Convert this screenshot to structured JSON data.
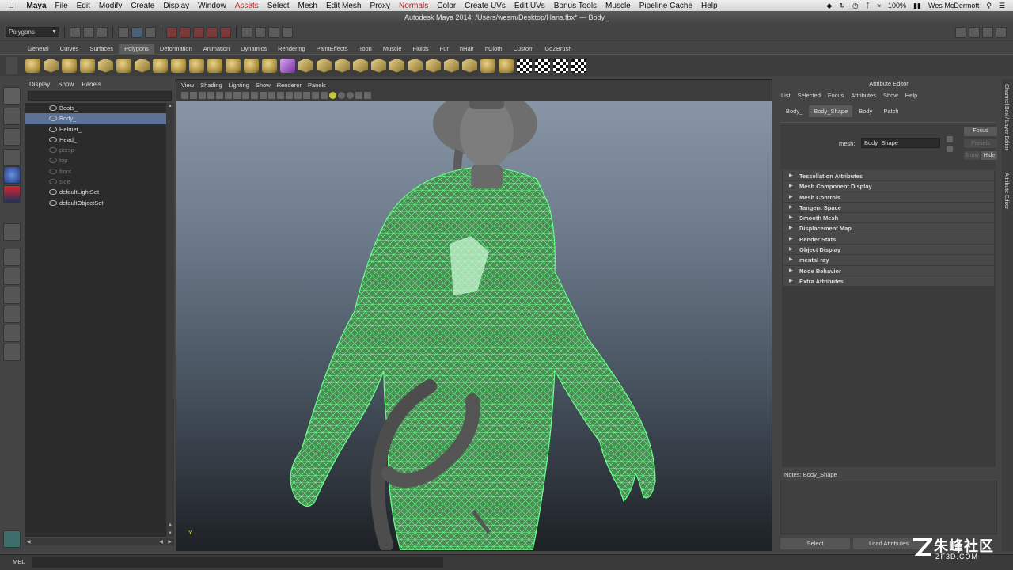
{
  "menubar": {
    "items": [
      "Maya",
      "File",
      "Edit",
      "Modify",
      "Create",
      "Display",
      "Window",
      "Assets",
      "Select",
      "Mesh",
      "Edit Mesh",
      "Proxy",
      "Normals",
      "Color",
      "Create UVs",
      "Edit UVs",
      "Bonus Tools",
      "Muscle",
      "Pipeline Cache",
      "Help"
    ],
    "battery": "100%",
    "user": "Wes McDermott"
  },
  "titlebar": {
    "title": "Autodesk Maya 2014: /Users/wesm/Desktop/Hans.fbx*  ---  Body_"
  },
  "statusline": {
    "menuset": "Polygons"
  },
  "shelf": {
    "tabs": [
      "General",
      "Curves",
      "Surfaces",
      "Polygons",
      "Deformation",
      "Animation",
      "Dynamics",
      "Rendering",
      "PaintEffects",
      "Toon",
      "Muscle",
      "Fluids",
      "Fur",
      "nHair",
      "nCloth",
      "Custom",
      "GoZBrush"
    ],
    "active_tab": "Polygons"
  },
  "outliner": {
    "menu": [
      "Display",
      "Show",
      "Panels"
    ],
    "items": [
      {
        "label": "Boots_",
        "state": "normal"
      },
      {
        "label": "Body_",
        "state": "selected"
      },
      {
        "label": "Helmet_",
        "state": "normal"
      },
      {
        "label": "Head_",
        "state": "normal"
      },
      {
        "label": "persp",
        "state": "dim"
      },
      {
        "label": "top",
        "state": "dim"
      },
      {
        "label": "front",
        "state": "dim"
      },
      {
        "label": "side",
        "state": "dim"
      },
      {
        "label": "defaultLightSet",
        "state": "normal"
      },
      {
        "label": "defaultObjectSet",
        "state": "normal"
      }
    ]
  },
  "viewport": {
    "menu": [
      "View",
      "Shading",
      "Lighting",
      "Show",
      "Renderer",
      "Panels"
    ],
    "axis_label": "Y",
    "wire_color": "#3cff6a"
  },
  "attribute_editor": {
    "title": "Attribute Editor",
    "menu": [
      "List",
      "Selected",
      "Focus",
      "Attributes",
      "Show",
      "Help"
    ],
    "tabs": [
      "Body_",
      "Body_Shape",
      "Body",
      "Patch"
    ],
    "active_tab": "Body_Shape",
    "mesh_label": "mesh:",
    "mesh_value": "Body_Shape",
    "focus_button": "Focus",
    "presets_button": "Presets",
    "show_button": "Show",
    "hide_button": "Hide",
    "sections": [
      "Tessellation Attributes",
      "Mesh Component Display",
      "Mesh Controls",
      "Tangent Space",
      "Smooth Mesh",
      "Displacement Map",
      "Render Stats",
      "Object Display",
      "mental ray",
      "Node Behavior",
      "Extra Attributes"
    ],
    "notes_label": "Notes:  Body_Shape",
    "select_button": "Select",
    "load_attributes_button": "Load Attributes"
  },
  "side_tabs": [
    "Channel Box / Layer Editor",
    "Attribute Editor"
  ],
  "cmdline": {
    "label": "MEL"
  },
  "watermark": {
    "brand": "朱峰社区",
    "url": "ZF3D.COM"
  }
}
